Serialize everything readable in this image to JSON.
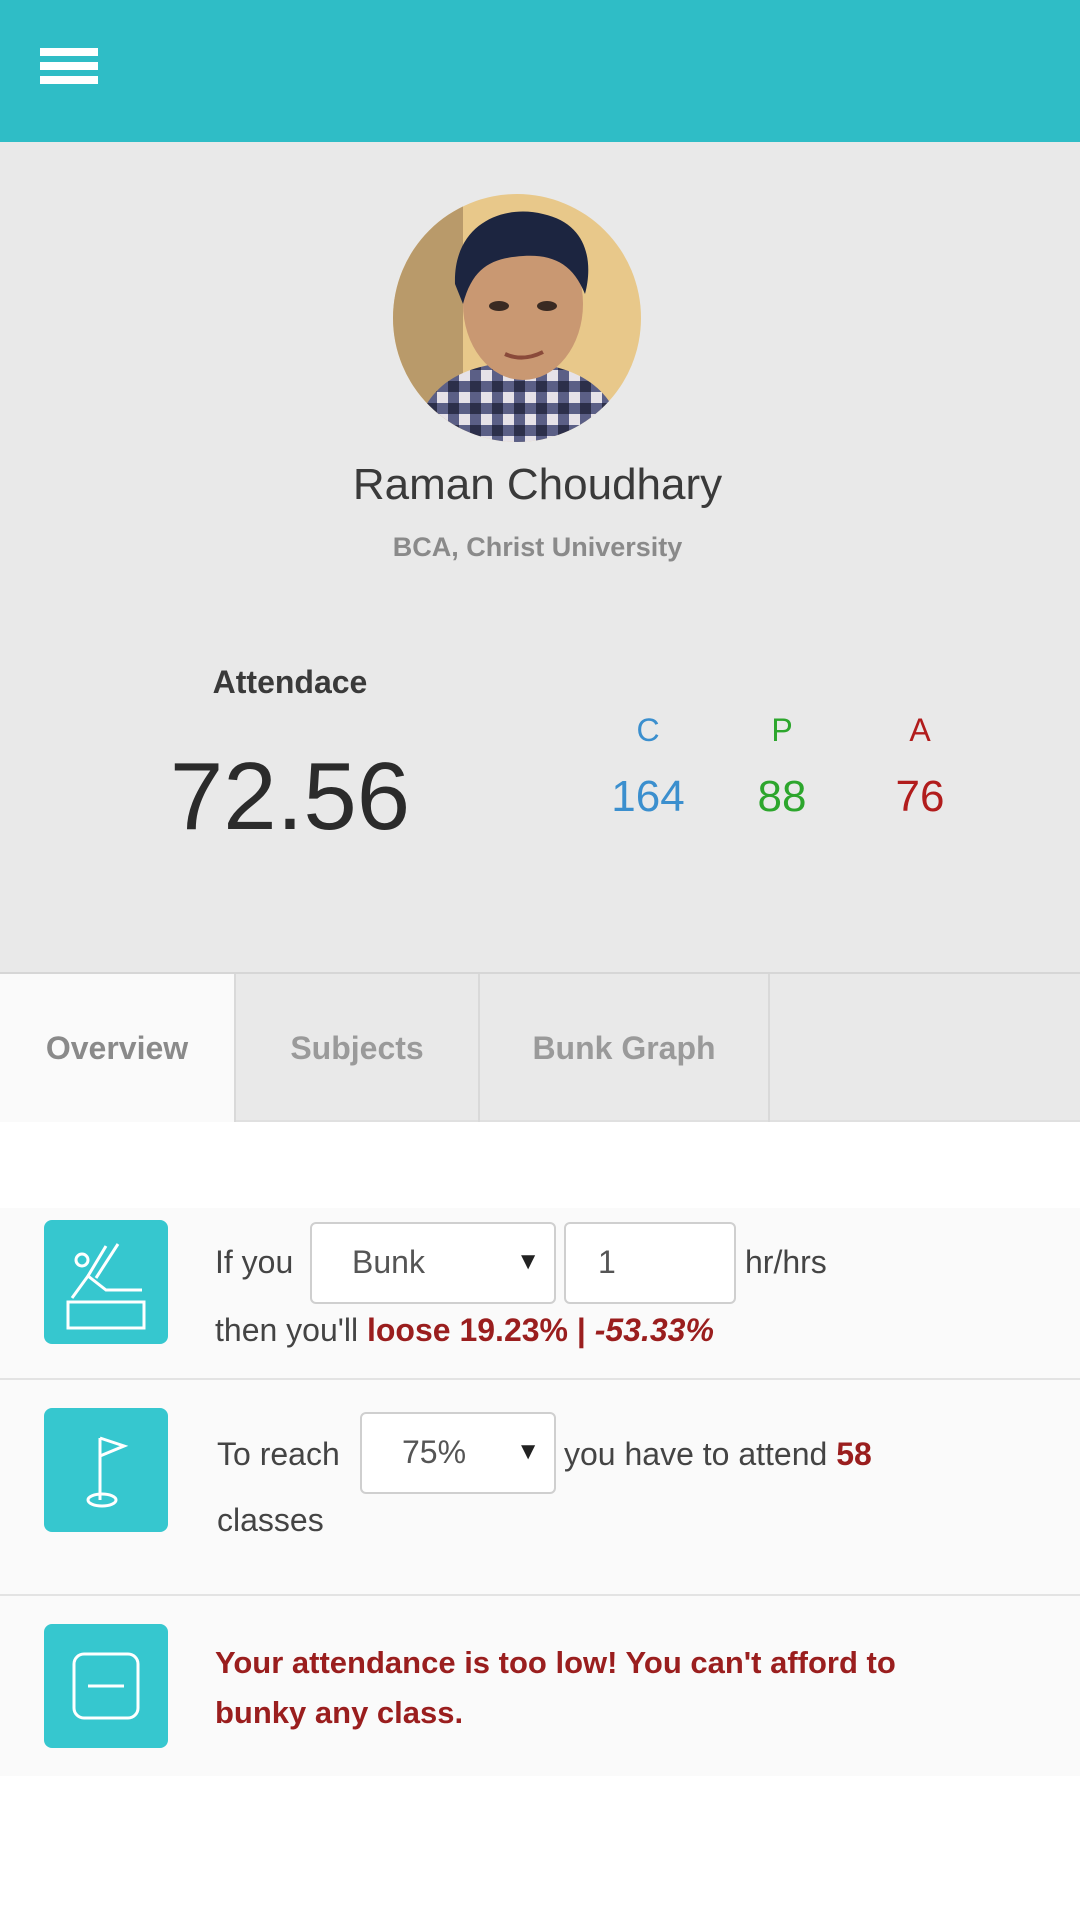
{
  "profile": {
    "name": "Raman Choudhary",
    "subtitle": "BCA, Christ University"
  },
  "attendance": {
    "label": "Attendace",
    "value": "72.56"
  },
  "stats": {
    "c": {
      "label": "C",
      "value": "164",
      "color": "#3b8fce"
    },
    "p": {
      "label": "P",
      "value": "88",
      "color": "#2da62d"
    },
    "a": {
      "label": "A",
      "value": "76",
      "color": "#b11c1c"
    }
  },
  "tabs": [
    {
      "label": "Overview",
      "active": true
    },
    {
      "label": "Subjects",
      "active": false
    },
    {
      "label": "Bunk Graph",
      "active": false
    }
  ],
  "bunk_card": {
    "icon": "bunk-icon",
    "prefix": "If you",
    "action_select": "Bunk",
    "hours_value": "1",
    "unit": "hr/hrs",
    "result_prefix": "then you'll",
    "result_value": "loose 19.23% |",
    "result_alt": "-53.33%"
  },
  "reach_card": {
    "icon": "flag-icon",
    "prefix": "To reach",
    "target_select": "75%",
    "middle": "you have to attend",
    "count": "58",
    "suffix": "classes"
  },
  "warning_card": {
    "icon": "minus-box-icon",
    "message": "Your attendance is too low! You can't afford to bunky any class."
  },
  "colors": {
    "primary": "#2fbdc6",
    "icon_bg": "#36c7cf",
    "alert": "#9a1e1e"
  }
}
